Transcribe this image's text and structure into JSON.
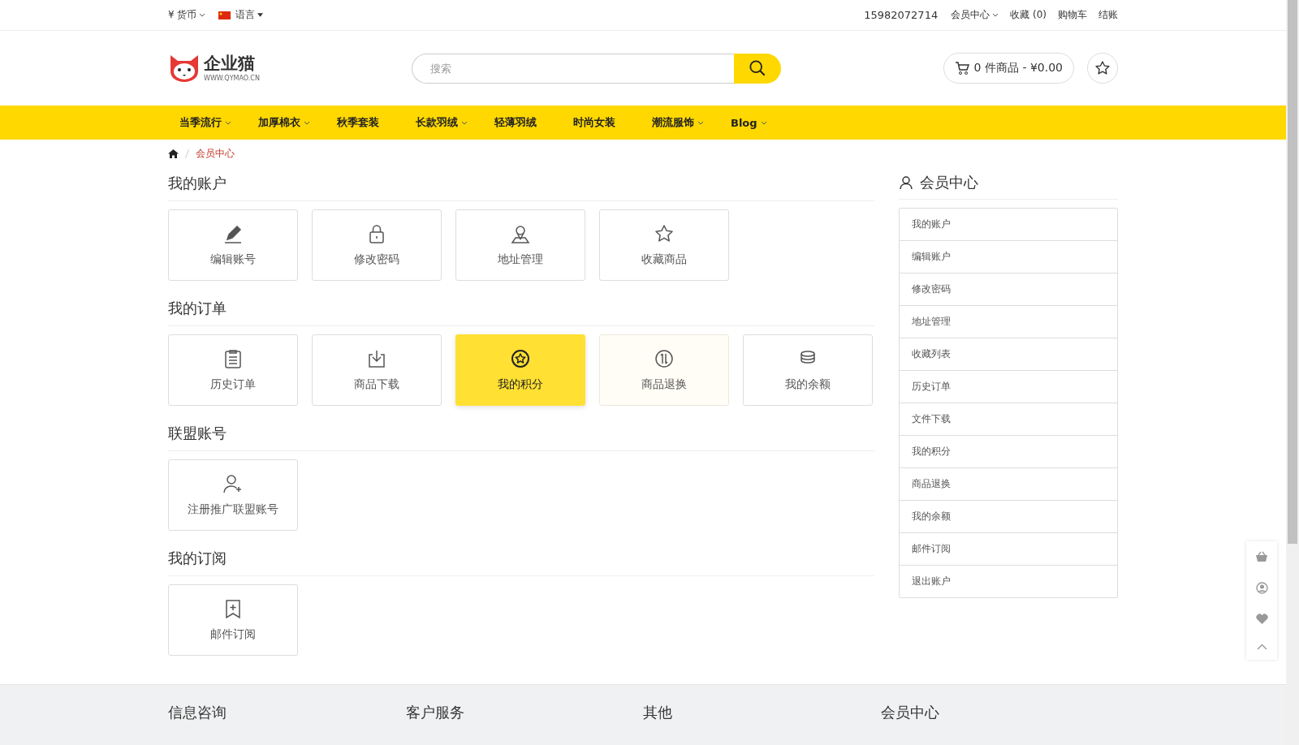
{
  "top_bar": {
    "currency": "¥ 货币",
    "language": "语言",
    "phone": "15982072714",
    "links": [
      {
        "label": "会员中心",
        "has_dropdown": true
      },
      {
        "label": "收藏 (0)",
        "has_dropdown": false
      },
      {
        "label": "购物车",
        "has_dropdown": false
      },
      {
        "label": "结账",
        "has_dropdown": false
      }
    ]
  },
  "header": {
    "logo_name": "企业猫",
    "logo_url": "WWW.QYMAO.CN",
    "search": {
      "placeholder": "搜索"
    },
    "cart": "0 件商品 - ¥0.00"
  },
  "nav": [
    {
      "label": "当季流行",
      "has_dropdown": true
    },
    {
      "label": "加厚棉衣",
      "has_dropdown": true
    },
    {
      "label": "秋季套装",
      "has_dropdown": false
    },
    {
      "label": "长款羽绒",
      "has_dropdown": true
    },
    {
      "label": "轻薄羽绒",
      "has_dropdown": false
    },
    {
      "label": "时尚女装",
      "has_dropdown": false
    },
    {
      "label": "潮流服饰",
      "has_dropdown": true
    },
    {
      "label": "Blog",
      "has_dropdown": true
    }
  ],
  "breadcrumb": [
    "会员中心"
  ],
  "sections": [
    {
      "title": "我的账户",
      "cards": [
        {
          "label": "编辑账号",
          "selected": false,
          "hovered": false
        },
        {
          "label": "修改密码",
          "selected": false,
          "hovered": false
        },
        {
          "label": "地址管理",
          "selected": false,
          "hovered": false
        },
        {
          "label": "收藏商品",
          "selected": false,
          "hovered": false
        }
      ]
    },
    {
      "title": "我的订单",
      "cards": [
        {
          "label": "历史订单",
          "selected": false,
          "hovered": false
        },
        {
          "label": "商品下载",
          "selected": false,
          "hovered": false
        },
        {
          "label": "我的积分",
          "selected": true,
          "hovered": false
        },
        {
          "label": "商品退换",
          "selected": false,
          "hovered": true
        },
        {
          "label": "我的余额",
          "selected": false,
          "hovered": false
        }
      ]
    },
    {
      "title": "联盟账号",
      "cards": [
        {
          "label": "注册推广联盟账号",
          "selected": false,
          "hovered": false
        }
      ]
    },
    {
      "title": "我的订阅",
      "cards": [
        {
          "label": "邮件订阅",
          "selected": false,
          "hovered": false
        }
      ]
    }
  ],
  "sidebar": {
    "title": "会员中心",
    "items": [
      "我的账户",
      "编辑账户",
      "修改密码",
      "地址管理",
      "收藏列表",
      "历史订单",
      "文件下载",
      "我的积分",
      "商品退换",
      "我的余额",
      "邮件订阅",
      "退出账户"
    ]
  },
  "footer": {
    "columns": [
      "信息咨询",
      "客户服务",
      "其他",
      "会员中心"
    ]
  }
}
